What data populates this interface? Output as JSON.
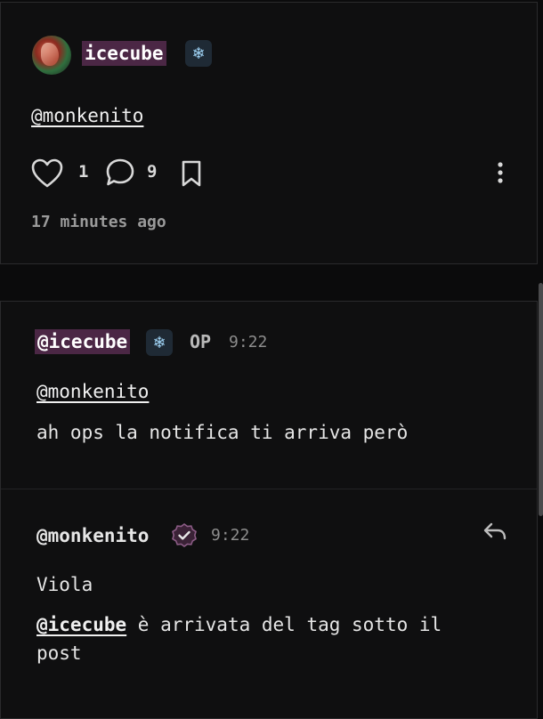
{
  "post": {
    "author": "icecube",
    "author_flair": "❄",
    "content_mention": "@monkenito",
    "like_count": "1",
    "comment_count": "9",
    "timestamp": "17 minutes ago"
  },
  "comments": [
    {
      "author": "@icecube",
      "flair": "❄",
      "op_label": "OP",
      "time": "9:22",
      "mention": "@monkenito",
      "text": "ah ops la notifica ti arriva però"
    },
    {
      "author": "@monkenito",
      "time": "9:22",
      "line1": "Viola",
      "mention": "@icecube",
      "line2_rest": " è arrivata del tag sotto il",
      "line3": "post"
    }
  ],
  "icons": {
    "like": "heart-icon",
    "comment": "comment-icon",
    "bookmark": "bookmark-icon",
    "more": "more-vertical-icon",
    "reply": "reply-icon",
    "verified": "verified-badge-icon"
  },
  "colors": {
    "background": "#0b0b0c",
    "card": "#0f0f10",
    "username_highlight": "#4b2745",
    "flair_bg": "#1f2a35",
    "verified_badge": "#6b3a63"
  }
}
